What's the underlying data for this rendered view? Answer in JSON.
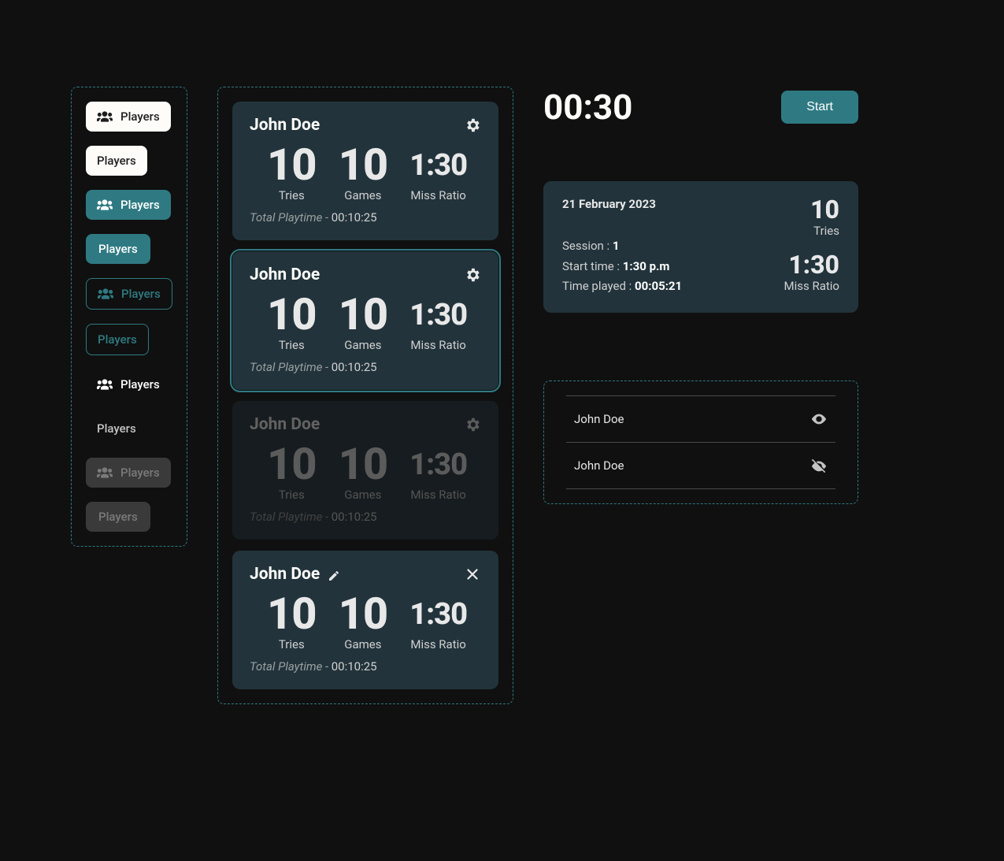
{
  "sidebar": {
    "buttons": [
      {
        "label": "Players",
        "variant": "white",
        "icon": true
      },
      {
        "label": "Players",
        "variant": "white",
        "icon": false
      },
      {
        "label": "Players",
        "variant": "teal",
        "icon": true
      },
      {
        "label": "Players",
        "variant": "teal-flat",
        "icon": false
      },
      {
        "label": "Players",
        "variant": "outline",
        "icon": true
      },
      {
        "label": "Players",
        "variant": "outline",
        "icon": false
      },
      {
        "label": "Players",
        "variant": "text",
        "icon": true
      },
      {
        "label": "Players",
        "variant": "text-dim",
        "icon": false
      },
      {
        "label": "Players",
        "variant": "disabled",
        "icon": true
      },
      {
        "label": "Players",
        "variant": "disabled-flat",
        "icon": false
      }
    ]
  },
  "label": {
    "tries": "Tries",
    "games": "Games",
    "miss_ratio": "Miss Ratio",
    "total_playtime_prefix": "Total Playtime - "
  },
  "cards": [
    {
      "name": "John Doe",
      "tries": "10",
      "games": "10",
      "miss_ratio": "1:30",
      "total_playtime": "00:10:25",
      "state": "default",
      "action": "gear"
    },
    {
      "name": "John Doe",
      "tries": "10",
      "games": "10",
      "miss_ratio": "1:30",
      "total_playtime": "00:10:25",
      "state": "selected",
      "action": "gear"
    },
    {
      "name": "John Doe",
      "tries": "10",
      "games": "10",
      "miss_ratio": "1:30",
      "total_playtime": "00:10:25",
      "state": "dim",
      "action": "gear"
    },
    {
      "name": "John Doe",
      "tries": "10",
      "games": "10",
      "miss_ratio": "1:30",
      "total_playtime": "00:10:25",
      "state": "edit",
      "action": "close"
    }
  ],
  "timer": {
    "value": "00:30",
    "start_label": "Start"
  },
  "session": {
    "date": "21 February 2023",
    "session_label": "Session : ",
    "session_num": "1",
    "start_time_label": "Start time : ",
    "start_time": "1:30 p.m",
    "time_played_label": "Time played : ",
    "time_played": "00:05:21",
    "tries": "10",
    "miss_ratio": "1:30"
  },
  "visibility_list": [
    {
      "name": "John Doe",
      "visible": true
    },
    {
      "name": "John Doe",
      "visible": false
    }
  ]
}
